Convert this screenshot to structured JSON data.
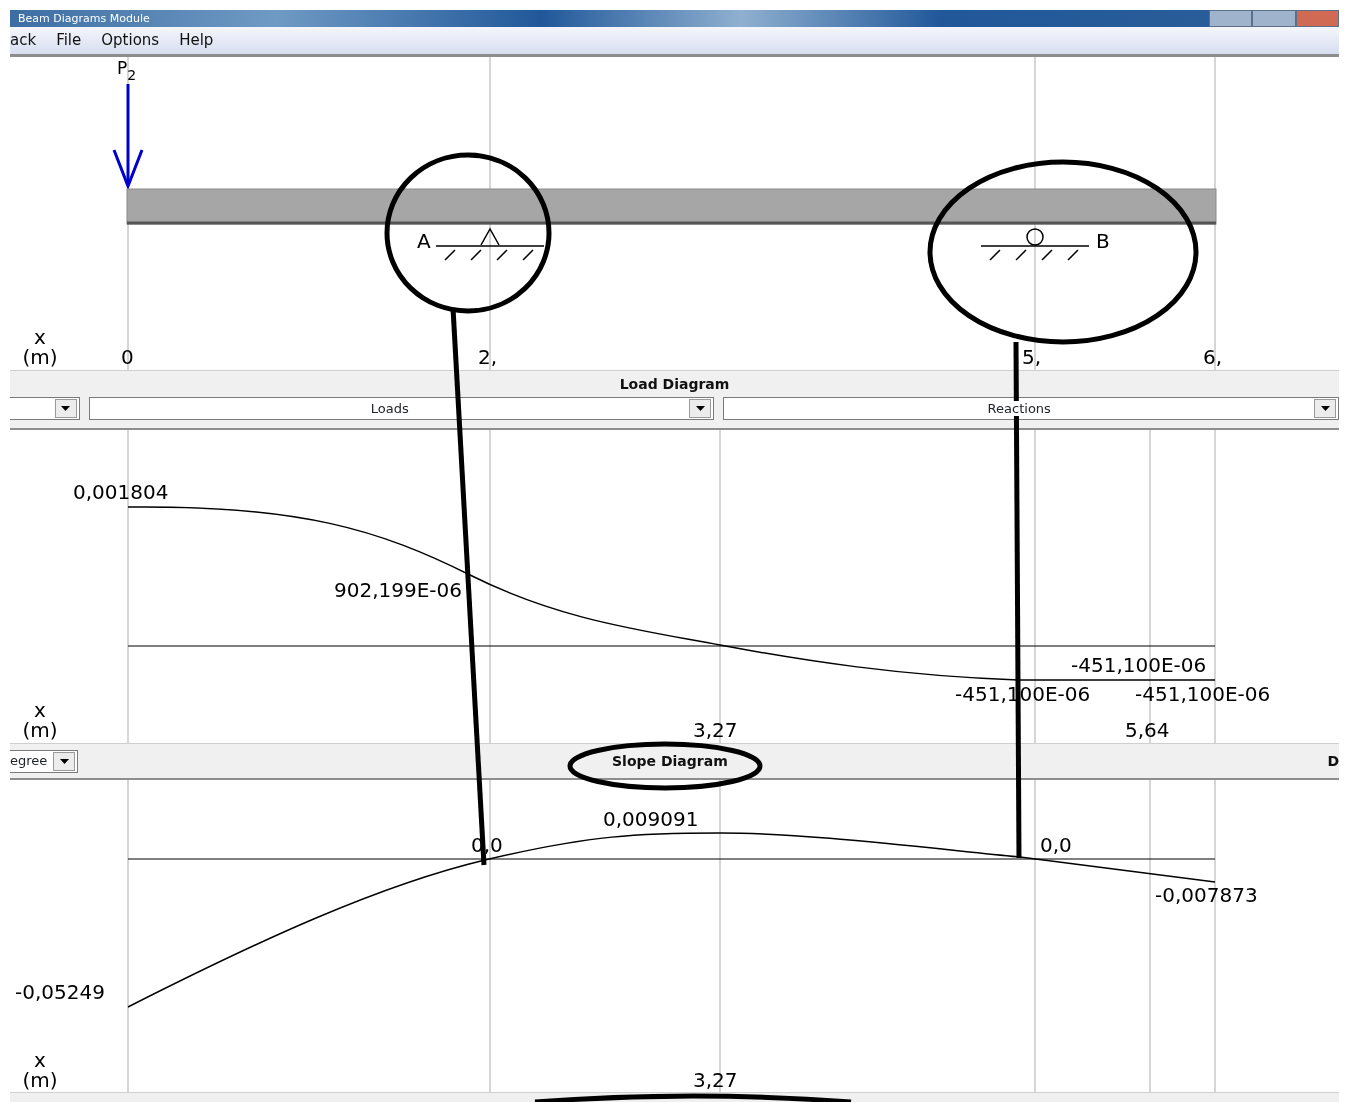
{
  "window": {
    "title": "Beam Diagrams Module"
  },
  "menu": [
    {
      "label": "ack"
    },
    {
      "label": "File"
    },
    {
      "label": "Options"
    },
    {
      "label": "Help"
    }
  ],
  "beam_view": {
    "load_label": "P$_{2}$",
    "supports": [
      {
        "kind": "pin",
        "label": "A"
      },
      {
        "kind": "roller",
        "label": "B"
      }
    ],
    "axis_label": "x",
    "axis_unit": "(m)",
    "ticks": [
      "0",
      "2,",
      "5,",
      "6,"
    ]
  },
  "load_bar": {
    "title": "Load Diagram",
    "dropdowns": [
      {
        "kind": "narrow"
      },
      {
        "kind": "wide",
        "value": "Loads"
      },
      {
        "kind": "wide",
        "value": "Reactions"
      }
    ]
  },
  "deflection_view": {
    "labels": [
      "0,001804",
      "902,199E-06",
      "-451,100E-06",
      "-451,100E-06",
      "-451,100E-06"
    ],
    "axis_label": "x",
    "axis_unit": "(m)",
    "ticks": [
      "3,27",
      "5,64"
    ]
  },
  "slope_bar": {
    "title": "Slope Diagram",
    "unit_dropdown": "egree",
    "right_edge": "D"
  },
  "slope_view": {
    "labels": [
      "0,009091",
      "0,0",
      "0,0",
      "-0,007873",
      "-0,05249"
    ],
    "axis_label": "x",
    "axis_unit": "(m)",
    "ticks": [
      "3,27"
    ]
  }
}
